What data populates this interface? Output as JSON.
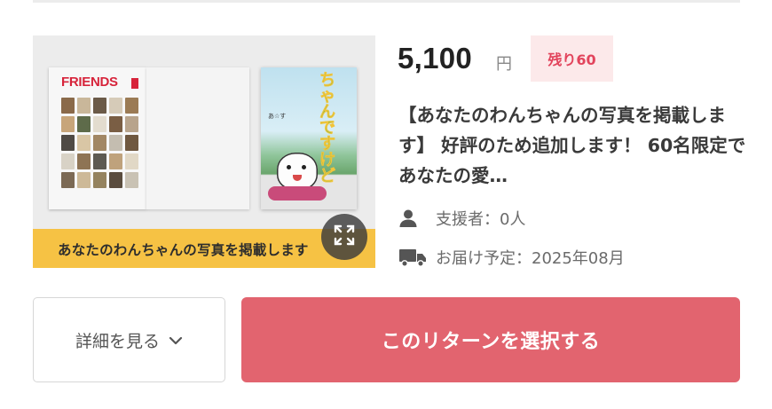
{
  "reward": {
    "price": "5,100",
    "currency": "円",
    "remaining_badge": "残り60",
    "description": "【あなたのわんちゃんの写真を掲載します】 好評のため追加します！ 60名限定であなたの愛…",
    "supporters_label": "支援者：0人",
    "delivery_label": "お届け予定：2025年08月"
  },
  "image": {
    "book_title": "FRIENDS",
    "banner_text": "あなたのわんちゃんの写真を掲載します",
    "cover_text": "ちゃんですけど"
  },
  "actions": {
    "details_label": "詳細を見る",
    "select_label": "このリターンを選択する"
  },
  "icons": {
    "supporters": "person-icon",
    "delivery": "truck-icon",
    "expand": "expand-icon",
    "details": "chevron-down-icon"
  },
  "colors": {
    "accent": "#e2646f",
    "badge_text": "#e2445c",
    "badge_bg": "#fce9ea",
    "banner": "#f6c244"
  }
}
